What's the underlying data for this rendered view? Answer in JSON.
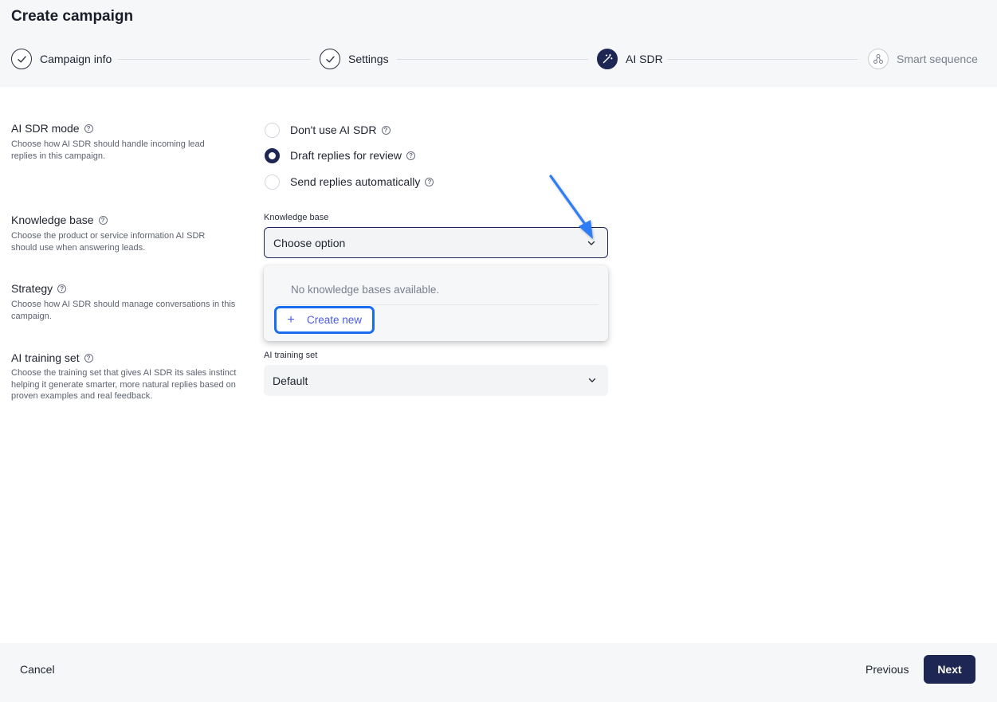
{
  "page": {
    "title": "Create campaign"
  },
  "stepper": {
    "steps": [
      {
        "label": "Campaign info",
        "state": "done"
      },
      {
        "label": "Settings",
        "state": "done"
      },
      {
        "label": "AI SDR",
        "state": "active"
      },
      {
        "label": "Smart sequence",
        "state": "pending"
      }
    ]
  },
  "ai_sdr_mode": {
    "label": "AI SDR mode",
    "description": "Choose how AI SDR should handle incoming lead replies in this campaign.",
    "options": [
      {
        "label": "Don't use AI SDR",
        "selected": false
      },
      {
        "label": "Draft replies for review",
        "selected": true
      },
      {
        "label": "Send replies automatically",
        "selected": false
      }
    ]
  },
  "knowledge_base": {
    "label": "Knowledge base",
    "description": "Choose the product or service information AI SDR should use when answering leads.",
    "field_label": "Knowledge base",
    "value": "Choose option",
    "dropdown": {
      "empty_text": "No knowledge bases available.",
      "create_label": "Create new"
    }
  },
  "strategy": {
    "label": "Strategy",
    "description": "Choose how AI SDR should manage conversations in this campaign."
  },
  "ai_training_set": {
    "label": "AI training set",
    "description": "Choose the training set that gives AI SDR its sales instinct helping it generate smarter, more natural replies based on proven examples and real feedback.",
    "field_label": "AI training set",
    "value": "Default"
  },
  "footer": {
    "cancel_label": "Cancel",
    "previous_label": "Previous",
    "next_label": "Next"
  },
  "colors": {
    "primary": "#1e2653",
    "highlight": "#1a6cf0",
    "link": "#4b5be0",
    "annotation_arrow": "#2f7cf6"
  }
}
